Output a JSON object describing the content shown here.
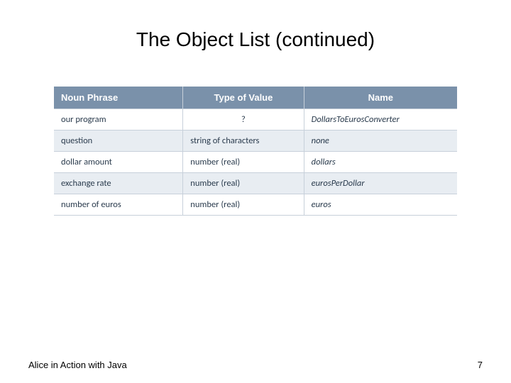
{
  "title": "The Object List (continued)",
  "table": {
    "headers": [
      "Noun Phrase",
      "Type of Value",
      "Name"
    ],
    "rows": [
      {
        "noun": "our program",
        "type": "?",
        "name": "DollarsToEurosConverter"
      },
      {
        "noun": "question",
        "type": "string of characters",
        "name": "none"
      },
      {
        "noun": "dollar amount",
        "type": "number (real)",
        "name": "dollars"
      },
      {
        "noun": "exchange rate",
        "type": "number (real)",
        "name": "eurosPerDollar"
      },
      {
        "noun": "number of euros",
        "type": "number (real)",
        "name": "euros"
      }
    ]
  },
  "footer": {
    "left": "Alice in Action with Java",
    "page": "7"
  }
}
